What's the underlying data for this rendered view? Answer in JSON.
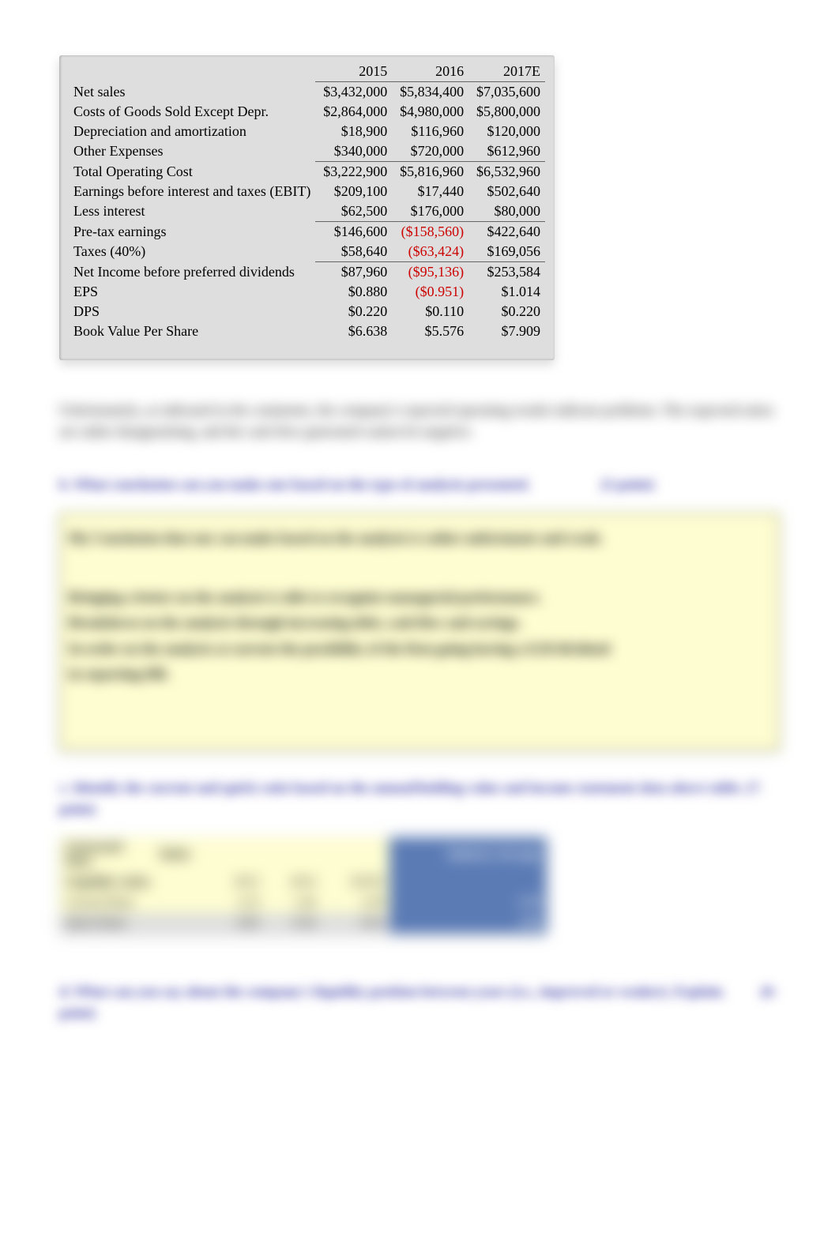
{
  "table": {
    "headers": {
      "c1": "2015",
      "c2": "2016",
      "c3": "2017E"
    },
    "rows": {
      "net_sales": {
        "label": "Net sales",
        "v1": "$3,432,000",
        "v2": "$5,834,400",
        "v3": "$7,035,600"
      },
      "cogs": {
        "label": "Costs of Goods Sold Except Depr.",
        "v1": "$2,864,000",
        "v2": "$4,980,000",
        "v3": "$5,800,000"
      },
      "dep": {
        "label": "Depreciation and amortization",
        "v1": "$18,900",
        "v2": "$116,960",
        "v3": "$120,000"
      },
      "other": {
        "label": "Other Expenses",
        "v1": "$340,000",
        "v2": "$720,000",
        "v3": "$612,960"
      },
      "total_cost": {
        "label": "Total Operating Cost",
        "v1": "$3,222,900",
        "v2": "$5,816,960",
        "v3": "$6,532,960"
      },
      "ebit": {
        "label": "Earnings before interest and taxes (EBIT)",
        "v1": "$209,100",
        "v2": "$17,440",
        "v3": "$502,640"
      },
      "interest": {
        "label": "Less interest",
        "v1": "$62,500",
        "v2": "$176,000",
        "v3": "$80,000"
      },
      "pretax": {
        "label": "Pre-tax earnings",
        "v1": "$146,600",
        "v2": "($158,560)",
        "v3": "$422,640"
      },
      "taxes": {
        "label": "Taxes (40%)",
        "v1": "$58,640",
        "v2": "($63,424)",
        "v3": "$169,056"
      },
      "net_income": {
        "label": "Net Income before preferred dividends",
        "v1": "$87,960",
        "v2": "($95,136)",
        "v3": "$253,584"
      },
      "eps": {
        "label": "EPS",
        "v1": "$0.880",
        "v2": "($0.951)",
        "v3": "$1.014"
      },
      "dps": {
        "label": "DPS",
        "v1": "$0.220",
        "v2": "$0.110",
        "v3": "$0.220"
      },
      "bvps": {
        "label": "Book Value Per Share",
        "v1": "$6.638",
        "v2": "$5.576",
        "v3": "$7.909"
      }
    }
  },
  "blurred": {
    "para1": "Unfortunately, as indicated in the comments, the company's expected operating results indicate problems. The expected ratios are rather disappointing, and the cash flow generated cannot be negative.",
    "q_b": "b. What conclusion can you make one based on the type of analysis presented.",
    "q_b_pts": "(5-point)",
    "panel_title": "My Conclusion that one can make based on the analysis is rather unfortunate and weak.",
    "panel_l1": "Bringing a better on the analysis is able to recognize managerial performance.",
    "panel_l2": "Breakdown on the analysis through increasing debt, cash flow and savings.",
    "panel_l3": "In order on the analysis at current the possibility of the firm going having a 0.20 dividend",
    "panel_l4": "in reporting HR.",
    "q_c": "c. Identify the current and quick ratio based on the annual/holding value and income statement data above table. (7-point)",
    "bt_h1": "Generated Data",
    "bt_h2": "Ratio",
    "bt_h3": "2013",
    "bt_h4": "2014",
    "bt_h5": "2015E",
    "bt_h6": "Industry Average",
    "bt_r1": "Liquidity ratios",
    "bt_r2": "Current Ratio",
    "bt_r2_1": "2.33",
    "bt_r2_2": "1.46",
    "bt_r2_3": "2.58",
    "bt_r2_4": "2.70",
    "bt_r3": "Quick Ratio",
    "bt_r3_1": "0.85",
    "bt_r3_2": "0.50",
    "bt_r3_3": "0.93",
    "bt_r3_4": "1.00",
    "q_d": "d. What can you say about the company's liquidity position between years           (i.e., improved or weaker). Explain.",
    "q_d_pts": "(6-point)"
  }
}
